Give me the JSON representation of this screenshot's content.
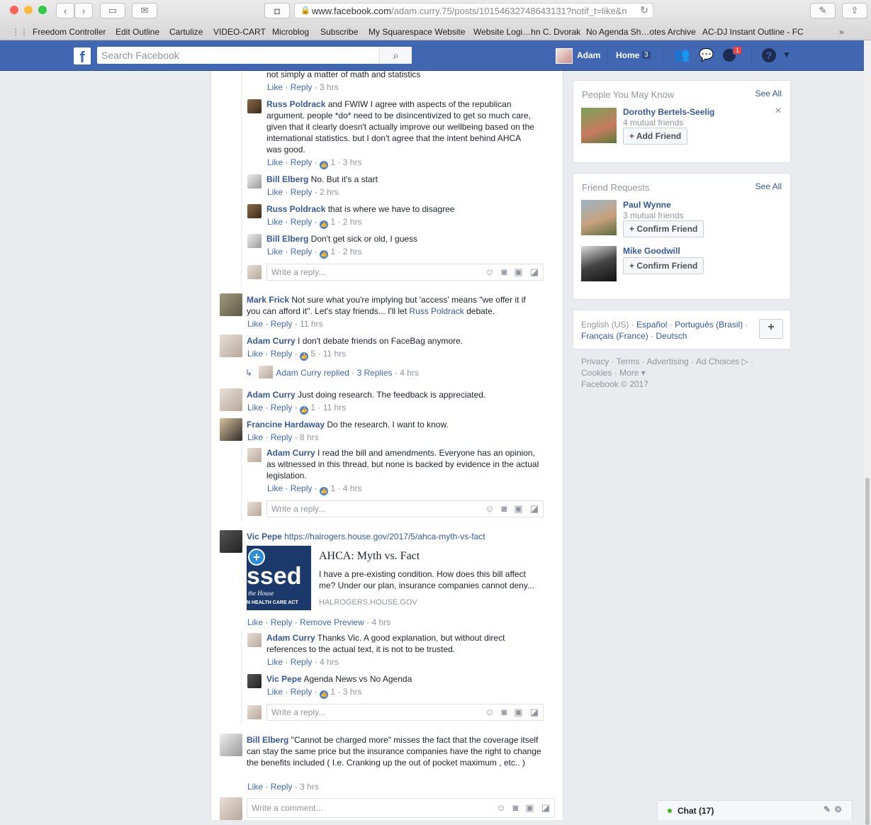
{
  "browser": {
    "url_domain": "www.facebook.com",
    "url_path": "/adam.curry.75/posts/10154632748643131?notif_t=like&n",
    "bookmarks": [
      "Freedom Controller",
      "Edit Outline",
      "Cartulize",
      "VIDEO-CART",
      "Microblog",
      "Subscribe",
      "My Squarespace Website",
      "Website Logi…hn C. Dvorak",
      "No Agenda Sh…otes Archive",
      "AC-DJ Instant Outline - FC"
    ]
  },
  "header": {
    "search_placeholder": "Search Facebook",
    "user_name": "Adam",
    "home_label": "Home",
    "home_count": "3",
    "notif_count": "1"
  },
  "feed": {
    "top_fragment": "not simply a matter of math and statistics",
    "like": "Like",
    "reply": "Reply",
    "remove_preview": "Remove Preview",
    "write_reply": "Write a reply...",
    "write_comment": "Write a comment...",
    "c0": {
      "time": "3 hrs"
    },
    "c1": {
      "name": "Russ Poldrack",
      "text": " and FWIW I agree with aspects of the republican argument. people *do* need to be disincentivized to get so much care, given that it clearly doesn't actually improve our wellbeing based on the international statistics. but I don't agree that the intent behind AHCA was good.",
      "likes": "1",
      "time": "3 hrs"
    },
    "c2": {
      "name": "Bill Elberg",
      "text": " No. But it's a start",
      "time": "2 hrs"
    },
    "c3": {
      "name": "Russ Poldrack",
      "text": " that is where we have to disagree",
      "likes": "1",
      "time": "2 hrs"
    },
    "c4": {
      "name": "Bill Elberg",
      "text": " Don't get sick or old, I guess",
      "likes": "1",
      "time": "2 hrs"
    },
    "c5": {
      "name": "Mark Frick",
      "text1": " Not sure what you're implying but 'access' means \"we offer it if you can afford it\". Let's stay friends... I'll let ",
      "mention": "Russ Poldrack",
      "text2": " debate.",
      "time": "11 hrs"
    },
    "c6": {
      "name": "Adam Curry",
      "text": " I don't debate friends on FaceBag anymore.",
      "likes": "5",
      "time": "11 hrs",
      "replied_name": "Adam Curry",
      "replied_text": "replied",
      "replies": "3 Replies",
      "replies_time": "4 hrs"
    },
    "c7": {
      "name": "Adam Curry",
      "text": " Just doing research. The feedback is appreciated.",
      "likes": "1",
      "time": "11 hrs"
    },
    "c8": {
      "name": "Francine Hardaway",
      "text": " Do the research. I want to know.",
      "time": "8 hrs"
    },
    "c9": {
      "name": "Adam Curry",
      "text": " I read the bill and amendments. Everyone has an opinion, as witnessed in this thread, but none is backed by evidence in the actual legislation.",
      "likes": "1",
      "time": "4 hrs"
    },
    "c10": {
      "name": "Vic Pepe",
      "link": "https://halrogers.house.gov/2017/5/ahca-myth-vs-fact",
      "time": "4 hrs",
      "preview_title": "AHCA: Myth vs. Fact",
      "preview_desc": "I have a pre-existing condition. How does this bill affect me? Under our plan, insurance companies cannot deny...",
      "preview_domain": "HALROGERS.HOUSE.GOV",
      "preview_img_big": "ssed",
      "preview_img_sub": "the House",
      "preview_img_foot": "N HEALTH CARE ACT"
    },
    "c11": {
      "name": "Adam Curry",
      "text": " Thanks Vic. A good explanation, but without direct references to the actual text, it is not to be trusted.",
      "time": "4 hrs"
    },
    "c12": {
      "name": "Vic Pepe",
      "text": " Agenda News vs No Agenda",
      "likes": "1",
      "time": "3 hrs"
    },
    "c13": {
      "name": "Bill Elberg",
      "text": " \"Cannot be charged more\" misses the fact that the coverage itself can stay the same price but the insurance companies have the right to change the benefits included ( I.e. Cranking up the out of pocket maximum , etc.. )",
      "time": "3 hrs"
    }
  },
  "sidebar": {
    "pymk_title": "People You May Know",
    "see_all": "See All",
    "pymk_name": "Dorothy Bertels-Seelig",
    "pymk_mutual": "4 mutual friends",
    "add_friend": "Add Friend",
    "fr_title": "Friend Requests",
    "fr1_name": "Paul Wynne",
    "fr1_mutual": "3 mutual friends",
    "confirm": "Confirm Friend",
    "fr2_name": "Mike Goodwill",
    "lang_current": "English (US)",
    "langs": [
      "Español",
      "Português (Brasil)",
      "Français (France)",
      "Deutsch"
    ],
    "footer1": [
      "Privacy",
      "Terms",
      "Advertising",
      "Ad Choices"
    ],
    "footer2": [
      "Cookies",
      "More"
    ],
    "copyright": "Facebook © 2017"
  },
  "chat": {
    "label": "Chat (17)"
  }
}
